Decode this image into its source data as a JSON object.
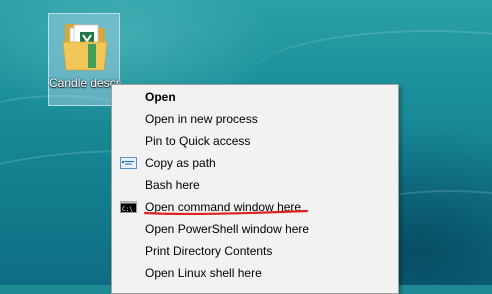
{
  "desktop_icon": {
    "label": "Candle description",
    "icon": "excel-folder-icon"
  },
  "context_menu": {
    "items": [
      {
        "label": "Open",
        "bold": true,
        "icon": null
      },
      {
        "label": "Open in new process",
        "bold": false,
        "icon": null
      },
      {
        "label": "Pin to Quick access",
        "bold": false,
        "icon": null
      },
      {
        "label": "Copy as path",
        "bold": false,
        "icon": "copy-path-icon"
      },
      {
        "label": "Bash here",
        "bold": false,
        "icon": null
      },
      {
        "label": "Open command window here",
        "bold": false,
        "icon": "command-prompt-icon",
        "highlighted": true
      },
      {
        "label": "Open PowerShell window here",
        "bold": false,
        "icon": null
      },
      {
        "label": "Print Directory Contents",
        "bold": false,
        "icon": null
      },
      {
        "label": "Open Linux shell here",
        "bold": false,
        "icon": null
      }
    ]
  },
  "colors": {
    "annotation": "#e02020",
    "menu_background": "#f2f2f2",
    "wallpaper": "#1a8e98"
  }
}
